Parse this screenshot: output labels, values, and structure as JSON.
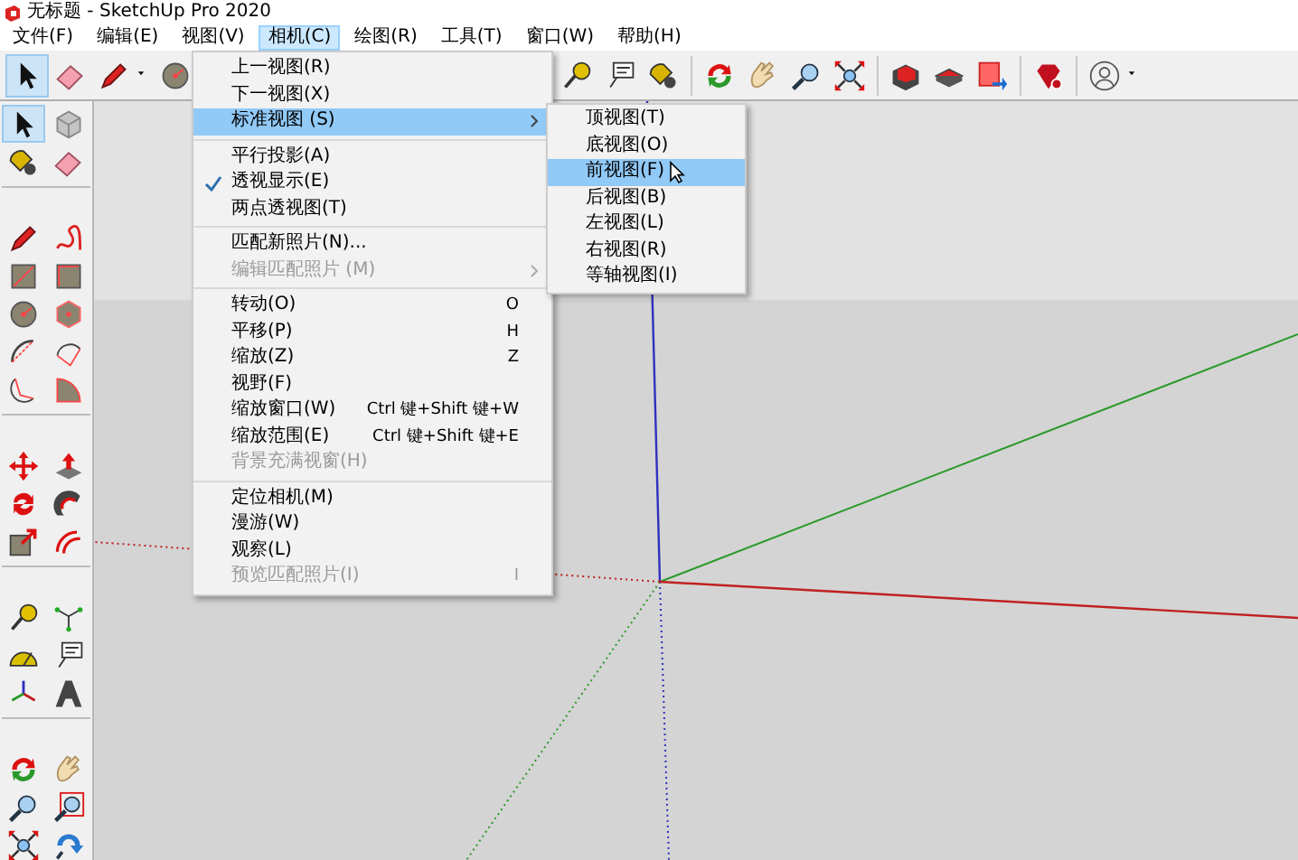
{
  "title_bar": {
    "title": "无标题 - SketchUp Pro 2020"
  },
  "menu_bar": [
    {
      "label": "文件(F)",
      "selected": false
    },
    {
      "label": "编辑(E)",
      "selected": false
    },
    {
      "label": "视图(V)",
      "selected": false
    },
    {
      "label": "相机(C)",
      "selected": true
    },
    {
      "label": "绘图(R)",
      "selected": false
    },
    {
      "label": "工具(T)",
      "selected": false
    },
    {
      "label": "窗口(W)",
      "selected": false
    },
    {
      "label": "帮助(H)",
      "selected": false
    }
  ],
  "camera_menu": {
    "items": [
      {
        "kind": "item",
        "label": "上一视图(R)",
        "selected": false,
        "checked": false,
        "disabled": false,
        "submenu": false
      },
      {
        "kind": "item",
        "label": "下一视图(X)",
        "selected": false,
        "checked": false,
        "disabled": false,
        "submenu": false
      },
      {
        "kind": "item",
        "label": "标准视图 (S)",
        "selected": true,
        "checked": false,
        "disabled": false,
        "submenu": true
      },
      {
        "kind": "separator"
      },
      {
        "kind": "item",
        "label": "平行投影(A)",
        "selected": false,
        "checked": false,
        "disabled": false,
        "submenu": false
      },
      {
        "kind": "item",
        "label": "透视显示(E)",
        "selected": false,
        "checked": true,
        "disabled": false,
        "submenu": false
      },
      {
        "kind": "item",
        "label": "两点透视图(T)",
        "selected": false,
        "checked": false,
        "disabled": false,
        "submenu": false
      },
      {
        "kind": "separator"
      },
      {
        "kind": "item",
        "label": "匹配新照片(N)...",
        "selected": false,
        "checked": false,
        "disabled": false,
        "submenu": false
      },
      {
        "kind": "item",
        "label": "编辑匹配照片 (M)",
        "selected": false,
        "checked": false,
        "disabled": true,
        "submenu": true
      },
      {
        "kind": "separator"
      },
      {
        "kind": "item",
        "label": "转动(O)",
        "shortcut": "O",
        "selected": false,
        "checked": false,
        "disabled": false,
        "submenu": false
      },
      {
        "kind": "item",
        "label": "平移(P)",
        "shortcut": "H",
        "selected": false,
        "checked": false,
        "disabled": false,
        "submenu": false
      },
      {
        "kind": "item",
        "label": "缩放(Z)",
        "shortcut": "Z",
        "selected": false,
        "checked": false,
        "disabled": false,
        "submenu": false
      },
      {
        "kind": "item",
        "label": "视野(F)",
        "selected": false,
        "checked": false,
        "disabled": false,
        "submenu": false
      },
      {
        "kind": "item",
        "label": "缩放窗口(W)",
        "shortcut": "Ctrl 键+Shift 键+W",
        "selected": false,
        "checked": false,
        "disabled": false,
        "submenu": false
      },
      {
        "kind": "item",
        "label": "缩放范围(E)",
        "shortcut": "Ctrl 键+Shift 键+E",
        "selected": false,
        "checked": false,
        "disabled": false,
        "submenu": false
      },
      {
        "kind": "item",
        "label": "背景充满视窗(H)",
        "selected": false,
        "checked": false,
        "disabled": true,
        "submenu": false
      },
      {
        "kind": "separator"
      },
      {
        "kind": "item",
        "label": "定位相机(M)",
        "selected": false,
        "checked": false,
        "disabled": false,
        "submenu": false
      },
      {
        "kind": "item",
        "label": "漫游(W)",
        "selected": false,
        "checked": false,
        "disabled": false,
        "submenu": false
      },
      {
        "kind": "item",
        "label": "观察(L)",
        "selected": false,
        "checked": false,
        "disabled": false,
        "submenu": false
      },
      {
        "kind": "item",
        "label": "预览匹配照片(I)",
        "shortcut": "I",
        "selected": false,
        "checked": false,
        "disabled": true,
        "submenu": false
      }
    ]
  },
  "standard_view_submenu": {
    "items": [
      {
        "label": "顶视图(T)",
        "selected": false
      },
      {
        "label": "底视图(O)",
        "selected": false
      },
      {
        "label": "前视图(F)",
        "selected": true
      },
      {
        "label": "后视图(B)",
        "selected": false
      },
      {
        "label": "左视图(L)",
        "selected": false
      },
      {
        "label": "右视图(R)",
        "selected": false
      },
      {
        "label": "等轴视图(I)",
        "selected": false
      }
    ]
  }
}
